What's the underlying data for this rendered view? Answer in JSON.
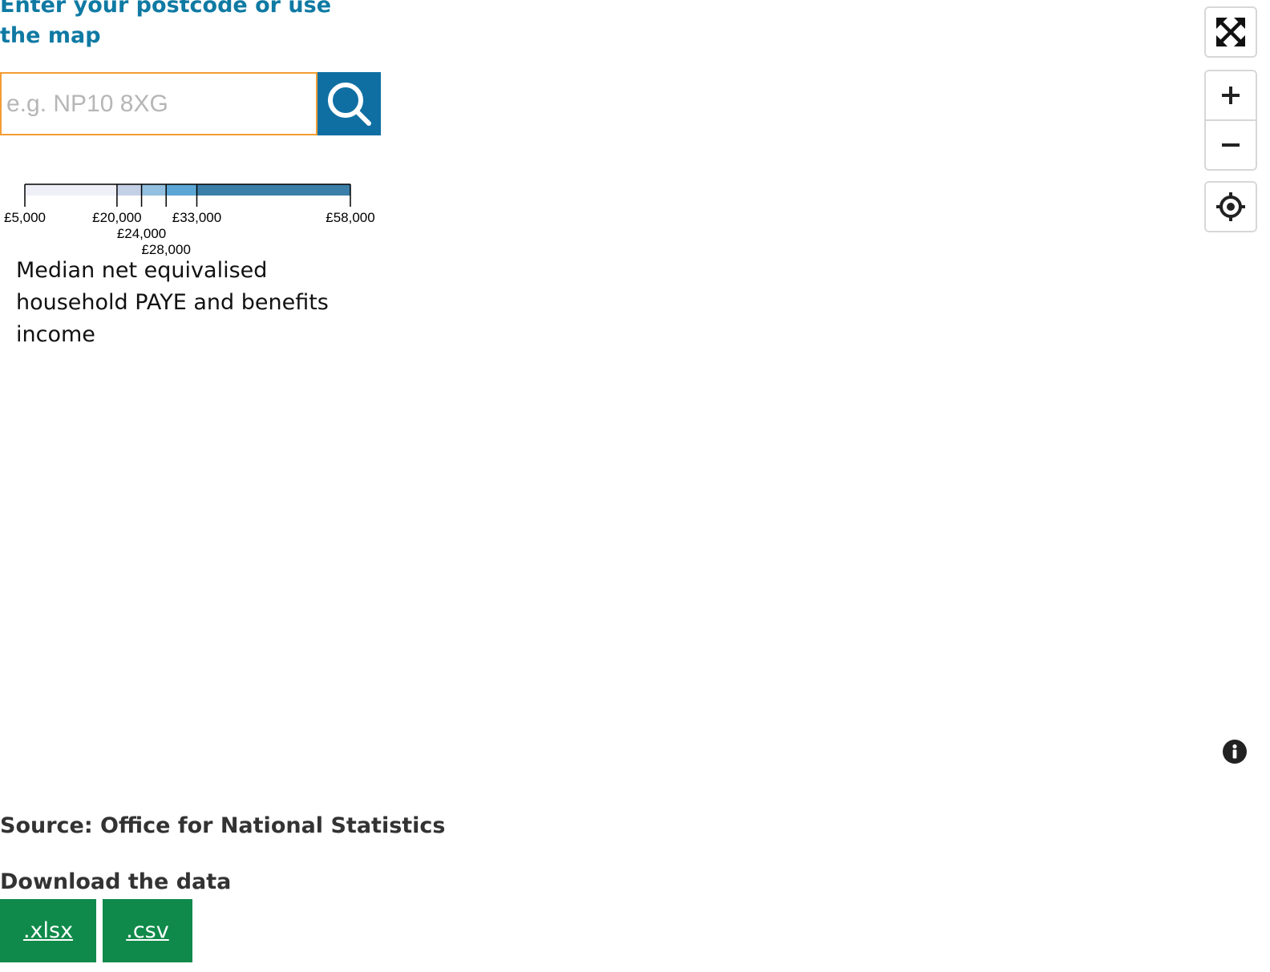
{
  "search": {
    "heading": "Enter your postcode or use the map",
    "placeholder": "e.g. NP10 8XG",
    "value": ""
  },
  "legend": {
    "breaks": [
      5000,
      20000,
      24000,
      28000,
      33000,
      58000
    ],
    "break_labels": [
      "£5,000",
      "£20,000",
      "£24,000",
      "£28,000",
      "£33,000",
      "£58,000"
    ],
    "colors": [
      "#eff0f7",
      "#c4d0e6",
      "#93bfe0",
      "#5ba6d4",
      "#3b7ea8"
    ],
    "title": "Median net equivalised household PAYE and benefits income"
  },
  "map_controls": {
    "fullscreen_icon": "fullscreen-icon",
    "zoom_in_icon": "plus-icon",
    "zoom_out_icon": "minus-icon",
    "locate_icon": "locate-icon",
    "info_icon": "info-icon"
  },
  "footer": {
    "source": "Source: Office for National Statistics",
    "download_heading": "Download the data",
    "downloads": [
      {
        "label": ".xlsx"
      },
      {
        "label": ".csv"
      }
    ]
  }
}
